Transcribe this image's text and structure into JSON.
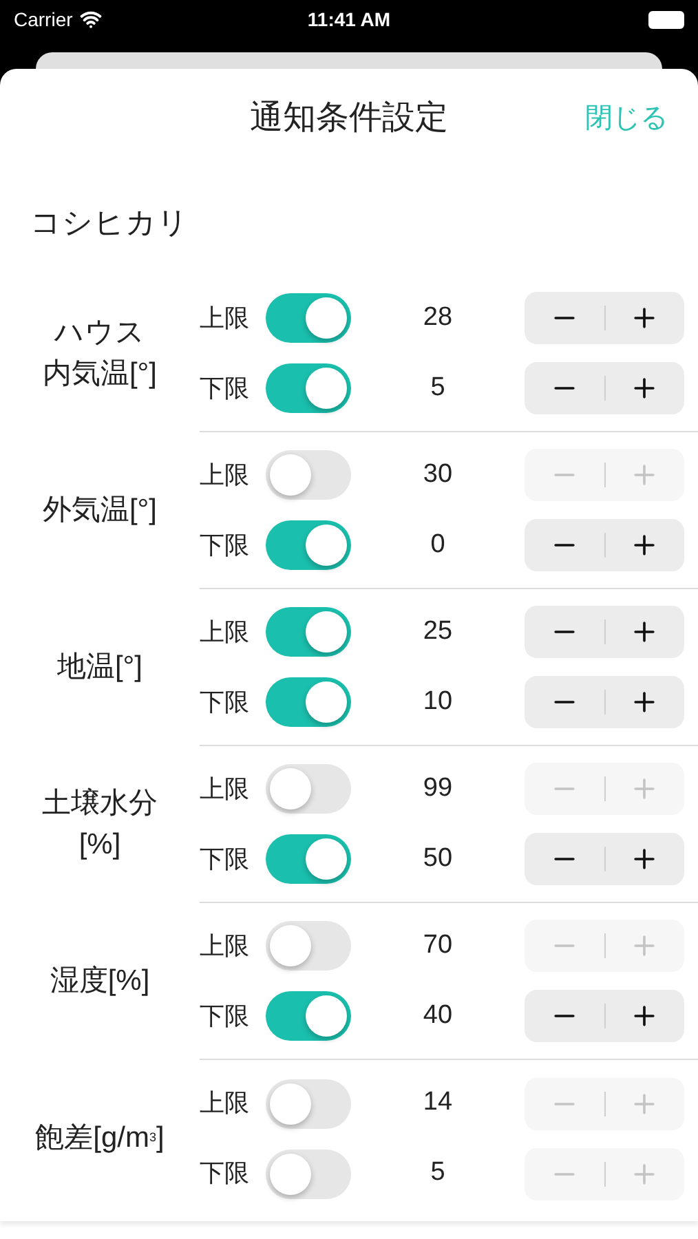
{
  "status_bar": {
    "carrier": "Carrier",
    "time": "11:41 AM"
  },
  "header": {
    "title": "通知条件設定",
    "close": "閉じる"
  },
  "crop": "コシヒカリ",
  "sensors": [
    {
      "name": [
        "ハウス",
        "内気温[°]"
      ],
      "rows": [
        {
          "label": "上限",
          "on": true,
          "value": "28"
        },
        {
          "label": "下限",
          "on": true,
          "value": "5"
        }
      ]
    },
    {
      "name": [
        "外気温[°]"
      ],
      "rows": [
        {
          "label": "上限",
          "on": false,
          "value": "30"
        },
        {
          "label": "下限",
          "on": true,
          "value": "0"
        }
      ]
    },
    {
      "name": [
        "地温[°]"
      ],
      "rows": [
        {
          "label": "上限",
          "on": true,
          "value": "25"
        },
        {
          "label": "下限",
          "on": true,
          "value": "10"
        }
      ]
    },
    {
      "name": [
        "土壌水分",
        "[%]"
      ],
      "rows": [
        {
          "label": "上限",
          "on": false,
          "value": "99"
        },
        {
          "label": "下限",
          "on": true,
          "value": "50"
        }
      ]
    },
    {
      "name": [
        "湿度[%]"
      ],
      "rows": [
        {
          "label": "上限",
          "on": false,
          "value": "70"
        },
        {
          "label": "下限",
          "on": true,
          "value": "40"
        }
      ]
    },
    {
      "name": [
        "飽差[g/m$^{3}$]"
      ],
      "rows": [
        {
          "label": "上限",
          "on": false,
          "value": "14"
        },
        {
          "label": "下限",
          "on": false,
          "value": "5"
        }
      ]
    }
  ]
}
